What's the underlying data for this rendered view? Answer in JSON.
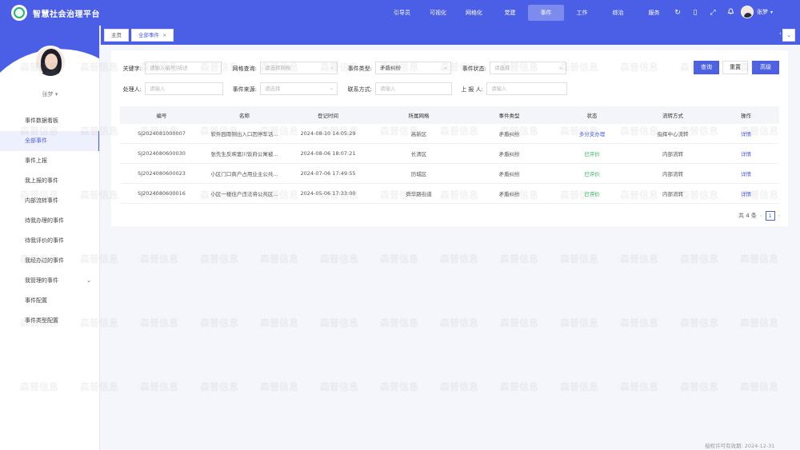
{
  "app": {
    "title": "智慧社会治理平台"
  },
  "nav": [
    "引导员",
    "可视化",
    "网格化",
    "党建",
    "事件",
    "工作",
    "综治",
    "服务"
  ],
  "nav_active": 4,
  "tools": {
    "refresh": "↻",
    "mobile": "▯",
    "fullscreen": "⤢",
    "bell": "🔔"
  },
  "user": {
    "name": "张梦",
    "caret": "▾"
  },
  "sidebar": {
    "profile_name": "张梦 ▾",
    "items": [
      "事件数据看板",
      "全部事件",
      "事件上报",
      "我上报的事件",
      "内部流转事件",
      "待我办理的事件",
      "待我评价的事件",
      "我经办过的事件",
      "我管理的事件",
      "事件配置",
      "事件类型配置"
    ],
    "active": 1,
    "caret": "⌄"
  },
  "tabs": {
    "home": "主页",
    "current": "全部事件",
    "close": "×",
    "left": "‹",
    "right": "⌄"
  },
  "filters": {
    "keyword_label": "关键字:",
    "keyword_placeholder": "请输入编号/描述",
    "grid_label": "网格查询:",
    "grid_placeholder": "请选择网格",
    "type_label": "事件类型:",
    "type_value": "矛盾纠纷",
    "status_label": "事件状态:",
    "status_placeholder": "请选择",
    "handler_label": "处理人:",
    "handler_placeholder": "请输入",
    "source_label": "事件来源:",
    "source_placeholder": "请选择",
    "contact_label": "联系方式:",
    "contact_placeholder": "请输入",
    "reporter_label": "上 报 人:",
    "reporter_placeholder": "请输入",
    "search": "查询",
    "reset": "重置",
    "advanced": "高级"
  },
  "table": {
    "headers": [
      "编号",
      "名称",
      "登记时间",
      "所属网格",
      "事件类型",
      "状态",
      "流转方式",
      "操作"
    ],
    "rows": [
      {
        "id": "SJ2024081000007",
        "name": "软件园南侧出入口因停车话...",
        "time": "2024-08-10 14:05:29",
        "grid": "高新区",
        "type": "矛盾纠纷",
        "status": "多分支办理",
        "flow": "指挥中心流转",
        "action": "详情"
      },
      {
        "id": "SJ2024080600030",
        "name": "张先生反映富川饭府公寓被...",
        "time": "2024-08-06 18:07:21",
        "grid": "长清区",
        "type": "矛盾纠纷",
        "status": "已评价",
        "flow": "内部流转",
        "action": "详情"
      },
      {
        "id": "SJ2024080600023",
        "name": "小区门口商户占用业主公共...",
        "time": "2024-07-06 17:49:55",
        "grid": "历城区",
        "type": "矛盾纠纷",
        "status": "已评价",
        "flow": "内部流转",
        "action": "详情"
      },
      {
        "id": "SJ2024080600016",
        "name": "小区一楼住户违法将公共区...",
        "time": "2024-05-06 17:33:00",
        "grid": "舜华路街道",
        "type": "矛盾纠纷",
        "status": "已评价",
        "flow": "内部流转",
        "action": "详情"
      }
    ]
  },
  "pager": {
    "total": "共 4 条",
    "prev": "‹",
    "page": "1",
    "next": "›"
  },
  "license": "授权许可有效期: 2024-12-31",
  "watermark": "森普信息",
  "colors": {
    "brand": "#4b5fe6",
    "success": "#2cb35b"
  }
}
